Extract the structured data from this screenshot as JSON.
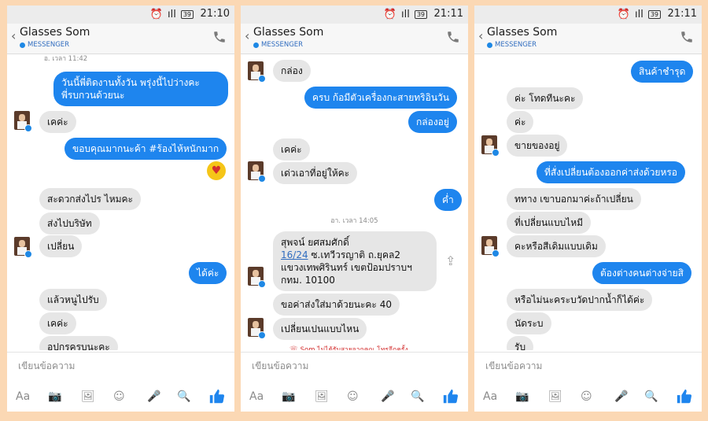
{
  "status": {
    "signal": "ıll",
    "battery": "39",
    "times": [
      "21:10",
      "21:11",
      "21:11"
    ]
  },
  "header": {
    "back": "‹",
    "title": "Glasses Som",
    "subtitle": "MESSENGER"
  },
  "compose": {
    "placeholder": "เขียนข้อความ",
    "aa": "Aa"
  },
  "screen1": {
    "stamp_top": "อ. เวลา 11:42",
    "msg1_line1": "วันนี้พี่ติดงานทั้งวัน พรุ่งนี้ไปว่างคะ",
    "msg1_line2": "พี่รบกวนด้วยนะ",
    "msg2": "เคค่ะ",
    "msg3": "ขอบคุณมากนะค้า #ร้องไห้หนักมาก",
    "msg4": "สะดวกส่งไปร ไหมคะ",
    "msg5": "ส่งไปบริษัท",
    "msg6": "เปลี่ยน",
    "msg7": "ได้ค่ะ",
    "msg8": "แล้วหนูไปรับ",
    "msg9": "เคค่ะ",
    "msg10": "อุปกรครบนะคะ"
  },
  "screen2": {
    "msg1": "กล่อง",
    "msg2": "ครบ ก้อมีตัวเครื่องกะสายทริอินวัน",
    "msg3": "กล่องอยู่",
    "msg4": "เคค่ะ",
    "msg5": "เด่วเอาที่อยู่ให้คะ",
    "msg6": "ค่ำ",
    "stamp": "อา. เวลา 14:05",
    "addr_line1": "สุพจน์ ยศสมศักดิ์",
    "addr_line2_link": "16/24",
    "addr_line2_rest": " ซ.เทวีวรญาติ ถ.ยุคล2",
    "addr_line3": "แขวงเทพศิรินทร์ เขตป้อมปราบฯ",
    "addr_line4": "กทม. 10100",
    "msg8": "ขอค่าส่งใส่มาด้วยนะคะ  40",
    "msg9": "เปลี่ยนเปนแบบไหน",
    "missed_text": "Som ไม่ได้รับสายจากคุณ",
    "missed_link": "โทรอีกครั้ง"
  },
  "screen3": {
    "msg1": "สินค้าชำรุด",
    "msg2": "ค่ะ โทดทีนะคะ",
    "msg3": "ค่ะ",
    "msg4": "ขายของอยู่",
    "msg5": "ที่สั่งเปลี่ยนต้องออกค่าส่งด้วยหรอ",
    "msg6": "ททาง เขาบอกมาค่ะถ้าเปลี่ยน",
    "msg7": "ที่เปลี่ยนแบบไหมี",
    "msg8": "คะหรือสีเดิมแบบเดิม",
    "msg9": "ต้องต่างคนต่างจ่ายสิ",
    "msg10": "หรือไม่นะคระบวัดปากน้ำก็ได้ค่ะ",
    "msg11": "นัดระบ",
    "msg12": "รับ"
  }
}
